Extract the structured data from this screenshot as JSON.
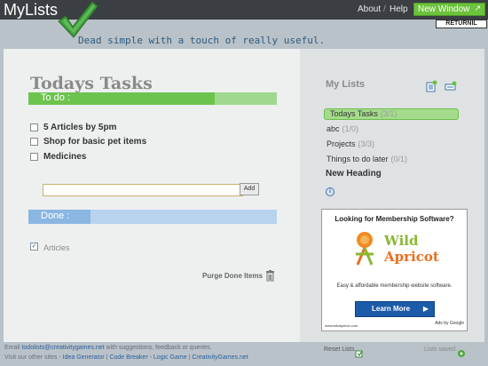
{
  "app_title": "MyLists",
  "tagline": "Dead simple with a touch of really useful.",
  "nav": {
    "about": "About",
    "separator": "/",
    "help": "Help"
  },
  "new_window_button": "New Window",
  "returnil_badge": "RETURNIL",
  "main": {
    "title": "Todays Tasks",
    "todo_label": "To do :",
    "todo_progress": 0.75,
    "tasks": [
      {
        "text": "5 Articles by 5pm",
        "checked": false
      },
      {
        "text": "Shop for basic pet items",
        "checked": false
      },
      {
        "text": "Medicines",
        "checked": false
      }
    ],
    "add_input_value": "",
    "add_button": "Add",
    "done_label": "Done :",
    "done_progress": 0.25,
    "done_items": [
      {
        "text": "Articles",
        "checked": true
      }
    ],
    "purge_label": "Purge Done Items"
  },
  "sidebar": {
    "title": "My Lists",
    "lists": [
      {
        "name": "Todays Tasks",
        "count": "(3/1)",
        "selected": true
      },
      {
        "name": "abc",
        "count": "(1/0)",
        "selected": false
      },
      {
        "name": "Projects",
        "count": "(3/3)",
        "selected": false
      },
      {
        "name": "Things to do later",
        "count": "(0/1)",
        "selected": false
      }
    ],
    "heading": "New Heading",
    "reset_label": "Reset Lists",
    "saved_label": "Lists saved."
  },
  "ad": {
    "headline": "Looking for Membership Software?",
    "brand_line_1": "Wild",
    "brand_line_2": "Apricot",
    "description": "Easy & affordable membership website software.",
    "button": "Learn More",
    "url": "www.wildapricot.com",
    "ads_by": "Ads by Google"
  },
  "footer": {
    "line1_prefix": "Email",
    "email": "todolists@creativitygames.net",
    "line1_suffix": "with suggestions, feedback or queries.",
    "line2_prefix": "Visit our other sites -",
    "link1": "Idea Generator",
    "sep": "|",
    "link2": "Code Breaker - Logic Game",
    "link3": "CreativityGames.net"
  },
  "colors": {
    "topbar": "#3b3e42",
    "accent_green": "#6cc23c",
    "done_blue": "#8ab7e2",
    "background": "#b9c2c9"
  }
}
